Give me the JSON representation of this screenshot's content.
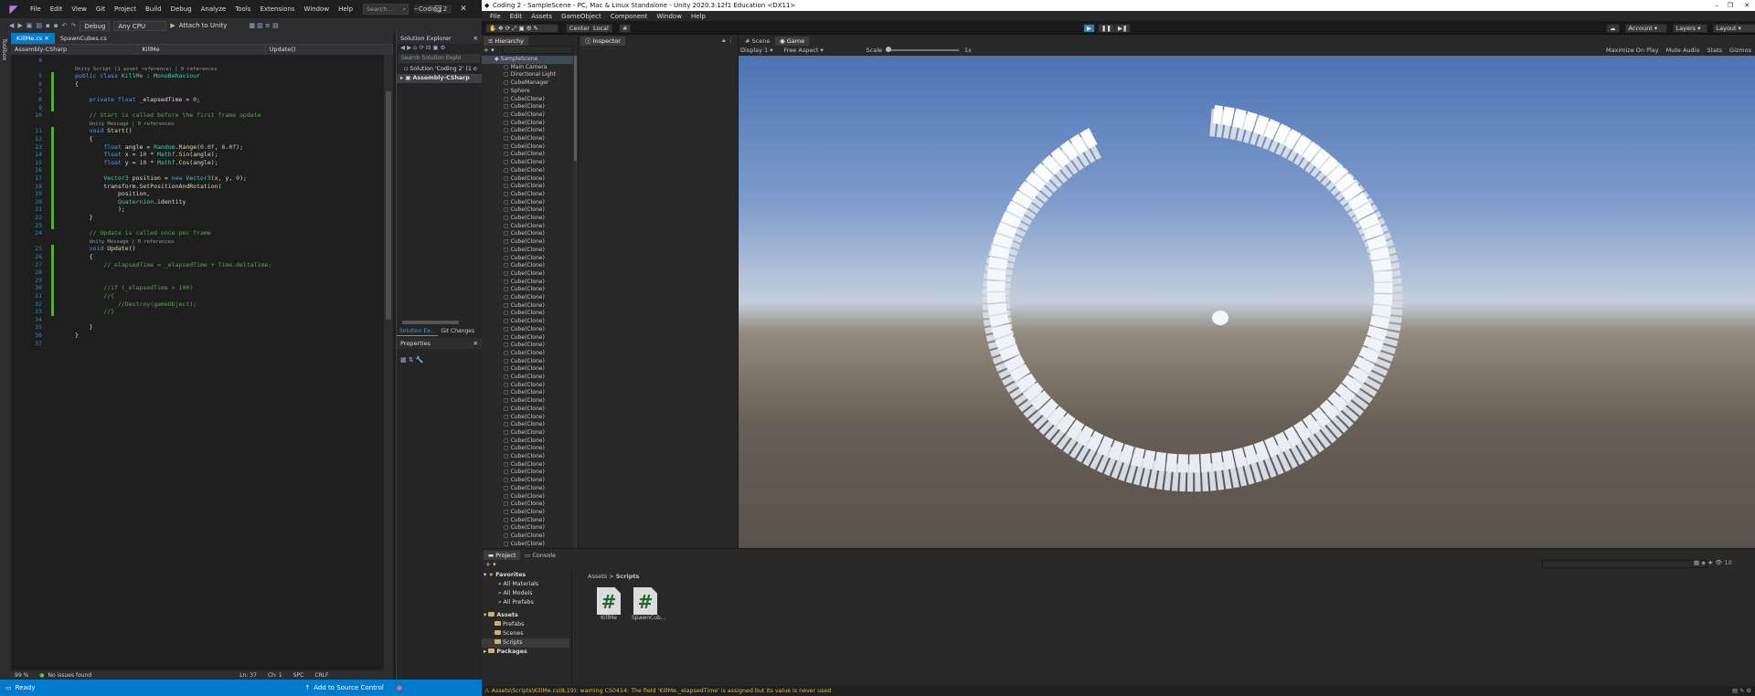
{
  "vs": {
    "title_menu": [
      "File",
      "Edit",
      "View",
      "Git",
      "Project",
      "Build",
      "Debug",
      "Analyze",
      "Tools",
      "Extensions",
      "Window",
      "Help"
    ],
    "search_placeholder": "Search...",
    "project_name": "Coding 2",
    "toolbar": {
      "config": "Debug",
      "platform": "Any CPU",
      "attach": "Attach to Unity"
    },
    "side_strip": "Toolbox",
    "tabs": [
      "KillMe.cs",
      "SpawnCubes.cs"
    ],
    "nav": {
      "project": "Assembly-CSharp",
      "class": "KillMe",
      "member": "Update()"
    },
    "code_lines": [
      {
        "n": "4",
        "html": ""
      },
      {
        "n": "",
        "html": "<span class='lens'>Unity Script (1 asset reference) | 0 references</span>"
      },
      {
        "n": "5",
        "html": "<span class='kw'>public class</span> <span class='ty'>KillMe</span> : <span class='ty'>MonoBehaviour</span>"
      },
      {
        "n": "6",
        "html": "{"
      },
      {
        "n": "7",
        "html": ""
      },
      {
        "n": "8",
        "html": "    <span class='kw'>private float</span> _elapsedTime = <span class='nm'>0</span>;"
      },
      {
        "n": "9",
        "html": ""
      },
      {
        "n": "10",
        "html": "    <span class='cm'>// Start is called before the first frame update</span>"
      },
      {
        "n": "",
        "html": "    <span class='lens'>Unity Message | 0 references</span>"
      },
      {
        "n": "11",
        "html": "    <span class='kw'>void</span> <span class='fn'>Start</span>()"
      },
      {
        "n": "12",
        "html": "    {"
      },
      {
        "n": "13",
        "html": "        <span class='kw'>float</span> angle = <span class='ty'>Random</span>.<span class='fn'>Range</span>(<span class='nm'>0.0f</span>, <span class='nm'>6.0f</span>);"
      },
      {
        "n": "14",
        "html": "        <span class='kw'>float</span> x = <span class='nm'>10</span> * <span class='ty'>Mathf</span>.<span class='fn'>Sin</span>(angle);"
      },
      {
        "n": "15",
        "html": "        <span class='kw'>float</span> y = <span class='nm'>10</span> * <span class='ty'>Mathf</span>.<span class='fn'>Cos</span>(angle);"
      },
      {
        "n": "16",
        "html": ""
      },
      {
        "n": "17",
        "html": "        <span class='ty'>Vector3</span> position = <span class='kw'>new</span> <span class='ty'>Vector3</span>(x, y, <span class='nm'>0</span>);"
      },
      {
        "n": "18",
        "html": "        transform.<span class='fn'>SetPositionAndRotation</span>("
      },
      {
        "n": "19",
        "html": "            position,"
      },
      {
        "n": "20",
        "html": "            <span class='ty'>Quaternion</span>.identity"
      },
      {
        "n": "21",
        "html": "            );"
      },
      {
        "n": "22",
        "html": "    }"
      },
      {
        "n": "23",
        "html": ""
      },
      {
        "n": "24",
        "html": "    <span class='cm'>// Update is called once per frame</span>"
      },
      {
        "n": "",
        "html": "    <span class='lens'>Unity Message | 0 references</span>"
      },
      {
        "n": "25",
        "html": "    <span class='kw'>void</span> <span class='fn'>Update</span>()"
      },
      {
        "n": "26",
        "html": "    {"
      },
      {
        "n": "27",
        "html": "        <span class='cm'>//_elapsedTime = _elapsedTime + Time.deltaTime;</span>"
      },
      {
        "n": "28",
        "html": ""
      },
      {
        "n": "29",
        "html": ""
      },
      {
        "n": "30",
        "html": "        <span class='cm'>//if (_elapsedTime &gt; 100)</span>"
      },
      {
        "n": "31",
        "html": "        <span class='cm'>//{</span>"
      },
      {
        "n": "32",
        "html": "            <span class='cm'>//Destroy(gameObject);</span>"
      },
      {
        "n": "33",
        "html": "        <span class='cm'>//}</span>"
      },
      {
        "n": "34",
        "html": ""
      },
      {
        "n": "35",
        "html": "    }"
      },
      {
        "n": "36",
        "html": "}"
      },
      {
        "n": "37",
        "html": ""
      }
    ],
    "editor_status": {
      "zoom": "99 %",
      "issues": "No issues found",
      "ln": "Ln: 37",
      "ch": "Ch: 1",
      "spc": "SPC",
      "crlf": "CRLF"
    },
    "statusbar": {
      "ready": "Ready",
      "source_control": "Add to Source Control"
    },
    "solution_explorer": {
      "title": "Solution Explorer",
      "search": "Search Solution Explo",
      "solution": "Solution 'Coding 2' (1 o",
      "project": "Assembly-CSharp",
      "tab1": "Solution Ex...",
      "tab2": "Git Changes"
    },
    "properties_title": "Properties"
  },
  "unity": {
    "title": "Coding 2 - SampleScene - PC, Mac & Linux Standalone - Unity 2020.3.12f1 Education <DX11>",
    "menu": [
      "File",
      "Edit",
      "Assets",
      "GameObject",
      "Component",
      "Window",
      "Help"
    ],
    "toolbar": {
      "center": "Center",
      "local": "Local",
      "account": "Account",
      "layers": "Layers",
      "layout": "Layout"
    },
    "hierarchy_tab": "Hierarchy",
    "inspector_tab": "Inspector",
    "scene_tab": "Scene",
    "game_tab": "Game",
    "game_bar": {
      "display": "Display 1",
      "aspect": "Free Aspect",
      "scale": "Scale",
      "scale_val": "1x",
      "maximize": "Maximize On Play",
      "mute": "Mute Audio",
      "stats": "Stats",
      "gizmos": "Gizmos"
    },
    "hierarchy": {
      "scene": "SampleScene",
      "fixed_items": [
        "Main Camera",
        "Directional Light",
        "CubeManager",
        "Sphere"
      ],
      "clone_label": "Cube(Clone)"
    },
    "project_tabs": {
      "project": "Project",
      "console": "Console"
    },
    "breadcrumb": {
      "root": "Assets",
      "sub": "Scripts"
    },
    "favorites": {
      "label": "Favorites",
      "items": [
        "All Materials",
        "All Models",
        "All Prefabs"
      ]
    },
    "assets": {
      "label": "Assets",
      "items": [
        "Prefabs",
        "Scenes",
        "Scripts"
      ]
    },
    "packages": "Packages",
    "files": [
      "KillMe",
      "SpawnCub..."
    ],
    "icon_count": "10",
    "console_warning": "Assets\\Scripts\\KillMe.cs(8,19): warning CS0414: The field 'KillMe._elapsedTime' is assigned but its value is never used"
  },
  "colors": {
    "vs_accent": "#007acc",
    "unity_warning": "#e6b83a",
    "cube_white": "#f2f5f8"
  }
}
